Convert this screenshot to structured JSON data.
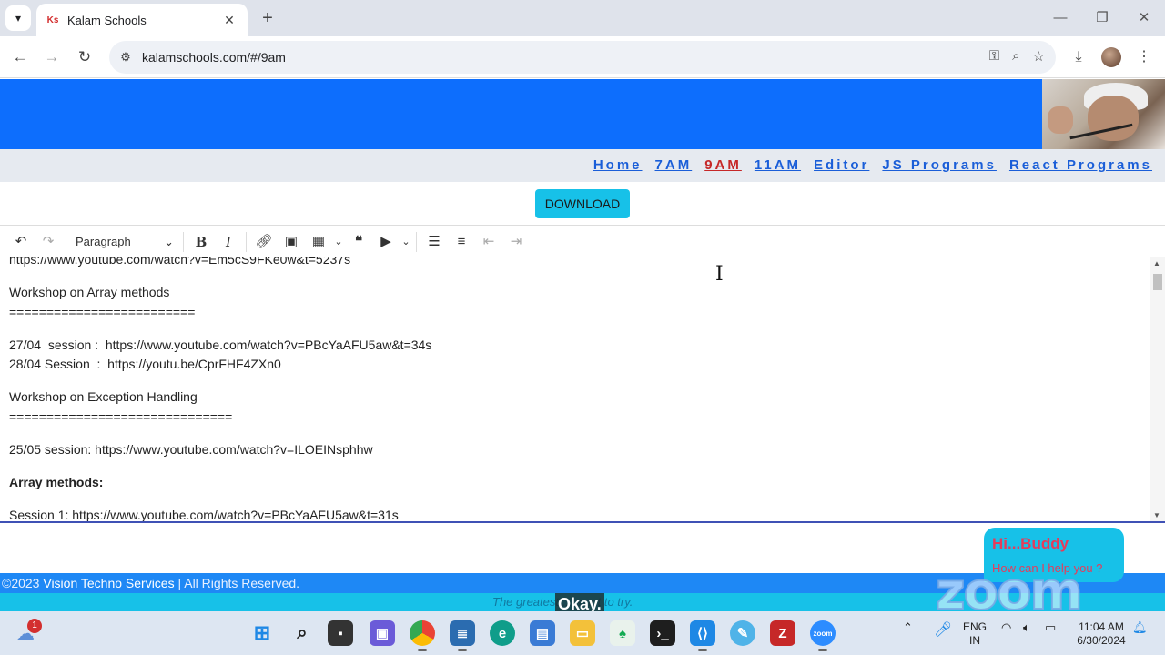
{
  "browser": {
    "tab": {
      "favicon": "Ks",
      "title": "Kalam Schools"
    },
    "url": "kalamschools.com/#/9am",
    "icons": [
      "chevron-down-icon",
      "close-icon",
      "plus-icon",
      "back-icon",
      "forward-icon",
      "reload-icon",
      "site-info-icon",
      "key-icon",
      "zoom-icon",
      "star-icon",
      "download-icon",
      "menu-icon"
    ]
  },
  "site": {
    "nav": [
      {
        "label": "Home",
        "active": false
      },
      {
        "label": "7AM",
        "active": false
      },
      {
        "label": "9AM",
        "active": true
      },
      {
        "label": "11AM",
        "active": false
      },
      {
        "label": "Editor",
        "active": false
      },
      {
        "label": "JS Programs",
        "active": false
      },
      {
        "label": "React Programs",
        "active": false
      }
    ],
    "download_label": "DOWNLOAD",
    "colors": {
      "banner": "#0d6efd",
      "download": "#17c1e8",
      "active_nav": "#c62828",
      "nav": "#1a5ed8"
    }
  },
  "editor": {
    "block_style": "Paragraph",
    "lines": [
      "https://www.youtube.com/watch?v=Em5cS9FKe0w&t=5237s",
      "Workshop on Array methods",
      "=========================",
      "27/04  session :  https://www.youtube.com/watch?v=PBcYaAFU5aw&t=34s",
      "28/04 Session  :  https://youtu.be/CprFHF4ZXn0",
      "Workshop on Exception Handling",
      "==============================",
      "25/05 session: https://www.youtube.com/watch?v=ILOEINsphhw",
      "Array methods:",
      "Session 1: https://www.youtube.com/watch?v=PBcYaAFU5aw&t=31s"
    ]
  },
  "footer": {
    "copyright_prefix": "©2023 ",
    "company": "Vision Techno Services",
    "copyright_suffix": " | All Rights Reserved.",
    "marquee": "The greatest ... s not to try.",
    "caption": "Okay."
  },
  "chat": {
    "title": "Hi...Buddy",
    "subtitle": "How can I help you ?"
  },
  "watermark": "zoom",
  "taskbar": {
    "weather_badge": "1",
    "language": [
      "ENG",
      "IN"
    ],
    "time": "11:04 AM",
    "date": "6/30/2024"
  }
}
